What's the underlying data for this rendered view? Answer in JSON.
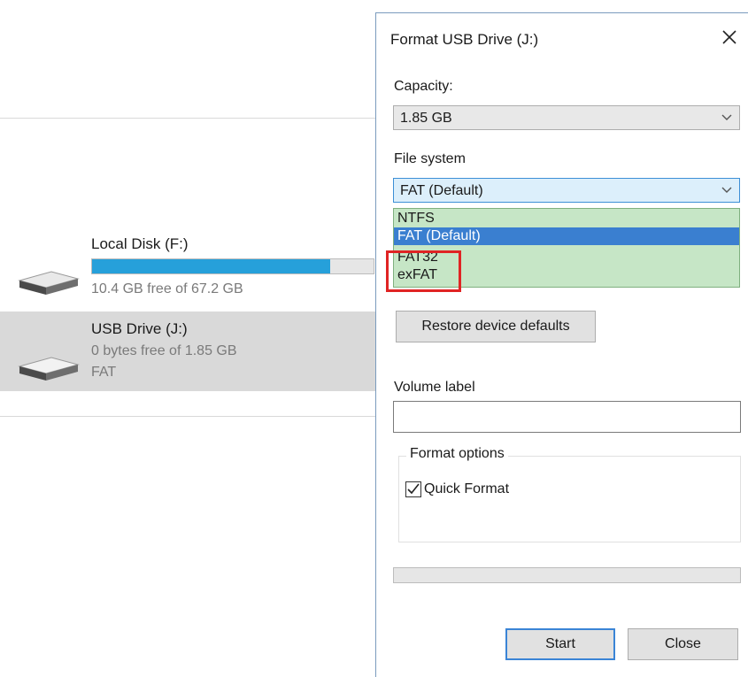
{
  "explorer": {
    "drives": [
      {
        "name": "Local Disk (F:)",
        "free_text": "10.4 GB free of 67.2 GB",
        "used_fraction": 0.845,
        "icon": "hard-drive-icon"
      },
      {
        "name": "USB Drive (J:)",
        "free_text": "0 bytes free of 1.85 GB",
        "fs_text": "FAT",
        "icon": "usb-drive-icon"
      }
    ]
  },
  "dialog": {
    "title": "Format USB Drive (J:)",
    "capacity_label": "Capacity:",
    "capacity_value": "1.85 GB",
    "filesystem_label": "File system",
    "filesystem_value": "FAT (Default)",
    "filesystem_options": [
      "NTFS",
      "FAT (Default)",
      "FAT32",
      "exFAT"
    ],
    "selected_option": "FAT (Default)",
    "restore_label": "Restore device defaults",
    "volume_label": "Volume label",
    "volume_value": "",
    "format_options_label": "Format options",
    "quick_format_label": "Quick Format",
    "quick_format_checked": true,
    "progress": 0,
    "start_label": "Start",
    "close_label": "Close"
  },
  "colors": {
    "accent": "#3a7fd0",
    "dropdown_list_bg": "#c6e6c6",
    "highlight_box": "#e02424",
    "usage_bar": "#26a0da"
  }
}
